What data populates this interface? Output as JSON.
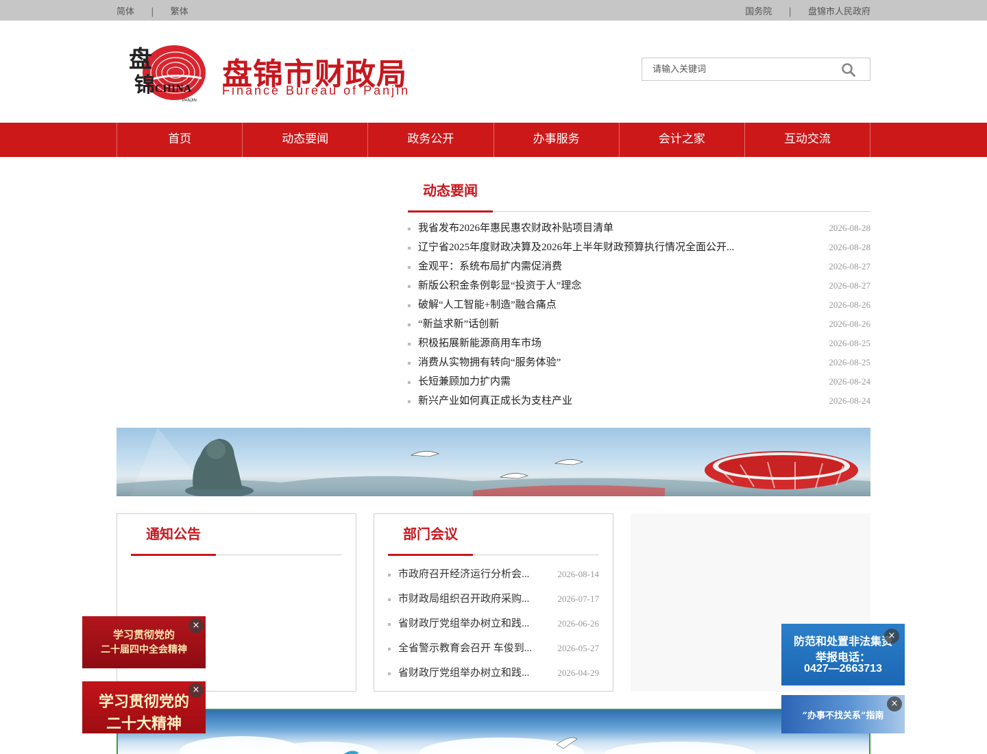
{
  "topbar": {
    "left_links": [
      "简体",
      "繁体"
    ],
    "right_links": [
      "国务院",
      "盘锦市人民政府"
    ],
    "separator": "|"
  },
  "logo": {
    "seal_text_1": "盘",
    "seal_text_2": "锦",
    "seal_text_3": "CHINA",
    "seal_text_4": "PANJIN",
    "title": "盘锦市财政局",
    "subtitle": "Finance Bureau of Panjin"
  },
  "search": {
    "placeholder": "请输入关键词"
  },
  "nav": [
    "首页",
    "动态要闻",
    "政务公开",
    "办事服务",
    "会计之家",
    "互动交流"
  ],
  "news": {
    "title": "动态要闻",
    "items": [
      {
        "title": "我省发布2026年惠民惠农财政补贴项目清单",
        "date": "2026-08-28"
      },
      {
        "title": "辽宁省2025年度财政决算及2026年上半年财政预算执行情况全面公开...",
        "date": "2026-08-28"
      },
      {
        "title": "金观平：系统布局扩内需促消费",
        "date": "2026-08-27"
      },
      {
        "title": "新版公积金条例彰显“投资于人”理念",
        "date": "2026-08-27"
      },
      {
        "title": "破解“人工智能+制造”融合痛点",
        "date": "2026-08-26"
      },
      {
        "title": "“新益求新”话创新",
        "date": "2026-08-26"
      },
      {
        "title": "积极拓展新能源商用车市场",
        "date": "2026-08-25"
      },
      {
        "title": "消费从实物拥有转向“服务体验”",
        "date": "2026-08-25"
      },
      {
        "title": "长短兼顾加力扩内需",
        "date": "2026-08-24"
      },
      {
        "title": "新兴产业如何真正成长为支柱产业",
        "date": "2026-08-24"
      }
    ]
  },
  "notice": {
    "title": "通知公告"
  },
  "meetings": {
    "title": "部门会议",
    "items": [
      {
        "title": "市政府召开经济运行分析会...",
        "date": "2026-08-14"
      },
      {
        "title": "市财政局组织召开政府采购...",
        "date": "2026-07-17"
      },
      {
        "title": "省财政厅党组举办树立和践...",
        "date": "2026-06-26"
      },
      {
        "title": "全省警示教育会召开 车俊到...",
        "date": "2026-05-27"
      },
      {
        "title": "省财政厅党组举办树立和践...",
        "date": "2026-04-29"
      }
    ]
  },
  "float_ads": {
    "ad1_line1": "学习贯彻党的",
    "ad1_line2": "二十届四中全会精神",
    "ad2_line1": "学习贯彻党的",
    "ad2_line2": "二十大精神",
    "ad3_line1": "防范和处置非法集资",
    "ad3_line2": "举报电话：",
    "ad3_line3": "0427—2663713",
    "ad4_line1": "“办事不找关系”指南",
    "close": "×"
  },
  "colors": {
    "brand_red": "#cd1819",
    "title_red": "#c8161d",
    "topbar_gray": "#c6c6c6"
  }
}
